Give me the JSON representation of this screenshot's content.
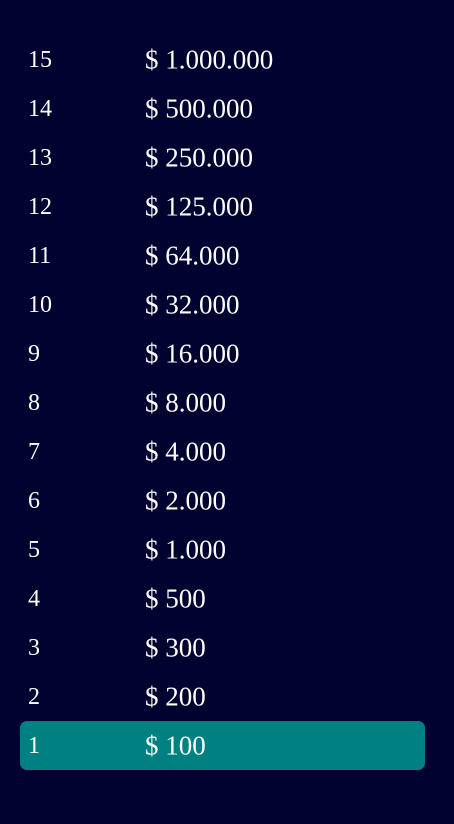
{
  "money_ladder": {
    "active_level": "1",
    "colors": {
      "background": "#020230",
      "active_row": "#008081",
      "text": "#ffffff"
    },
    "levels": [
      {
        "number": "15",
        "amount": "$ 1.000.000"
      },
      {
        "number": "14",
        "amount": "$ 500.000"
      },
      {
        "number": "13",
        "amount": "$ 250.000"
      },
      {
        "number": "12",
        "amount": "$ 125.000"
      },
      {
        "number": "11",
        "amount": "$ 64.000"
      },
      {
        "number": "10",
        "amount": "$ 32.000"
      },
      {
        "number": "9",
        "amount": "$ 16.000"
      },
      {
        "number": "8",
        "amount": "$ 8.000"
      },
      {
        "number": "7",
        "amount": "$ 4.000"
      },
      {
        "number": "6",
        "amount": "$ 2.000"
      },
      {
        "number": "5",
        "amount": "$ 1.000"
      },
      {
        "number": "4",
        "amount": "$ 500"
      },
      {
        "number": "3",
        "amount": "$ 300"
      },
      {
        "number": "2",
        "amount": "$ 200"
      },
      {
        "number": "1",
        "amount": "$ 100"
      }
    ]
  }
}
